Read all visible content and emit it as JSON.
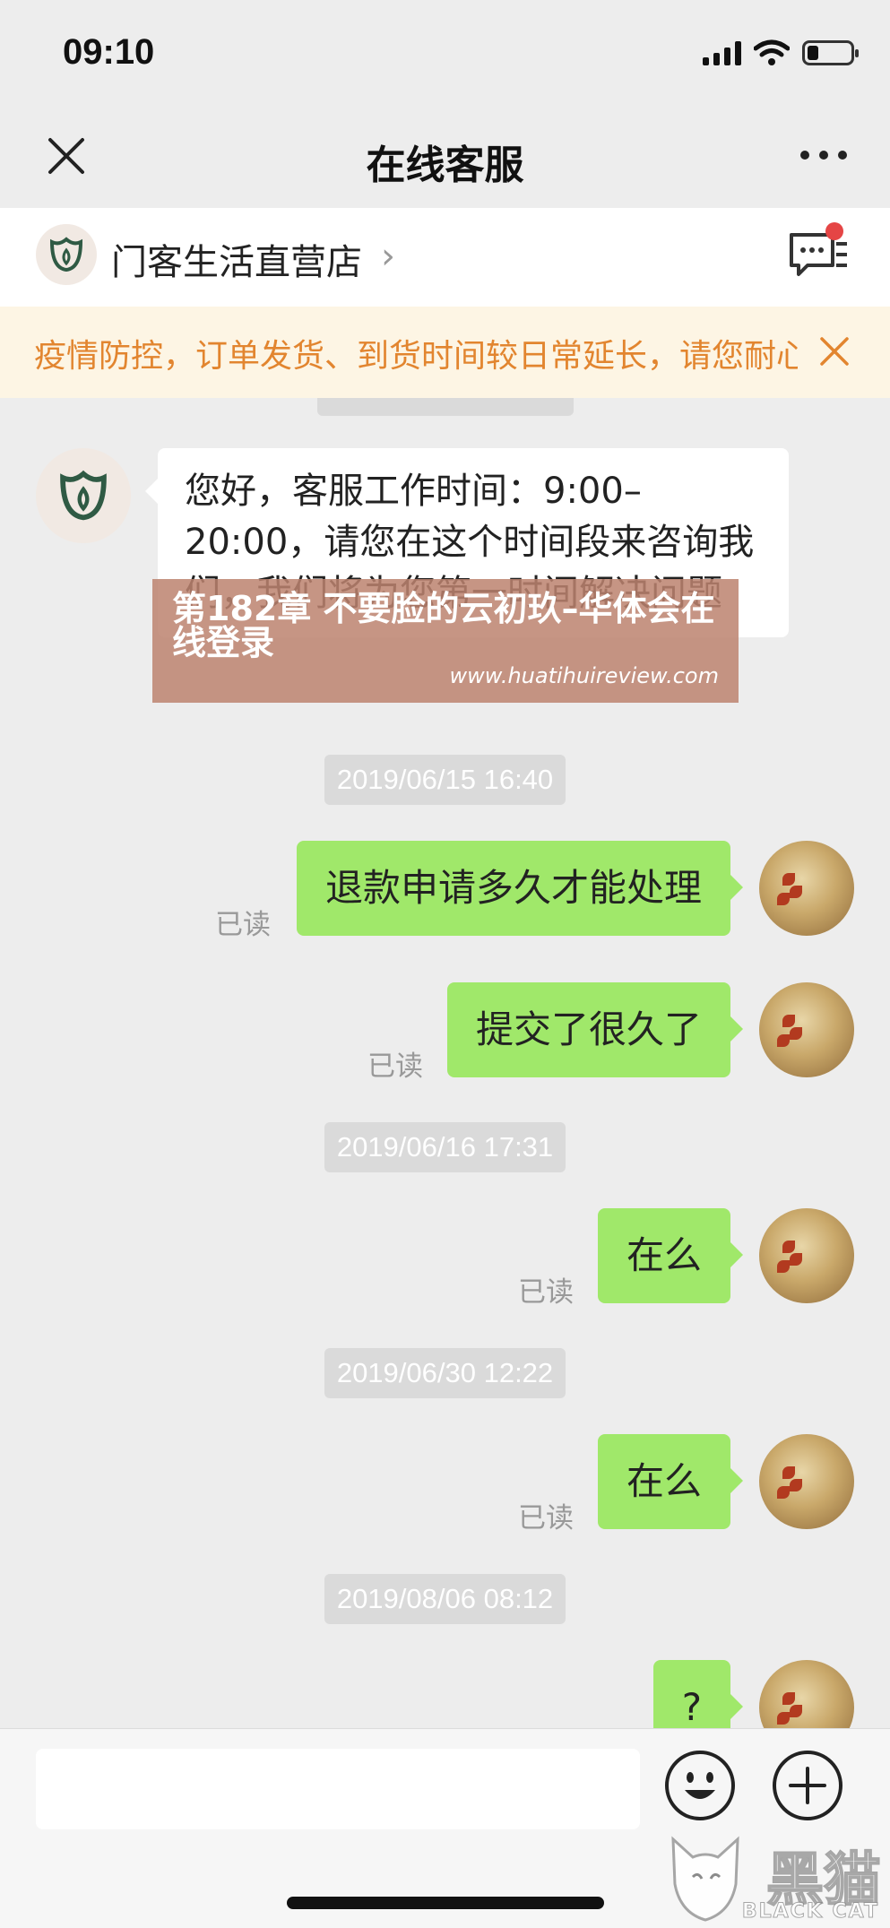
{
  "status": {
    "time": "09:10"
  },
  "nav": {
    "title": "在线客服"
  },
  "shop": {
    "name": "门客生活直营店",
    "chevron": "›"
  },
  "notice": {
    "text": "疫情防控，订单发货、到货时间较日常延长，请您耐心等待"
  },
  "messages": {
    "greeting": "您好，客服工作时间：9:00–20:00，请您在这个时间段来咨询我们，我们将为您第一时间解决问题",
    "ts1": "2019/06/15 16:40",
    "m1": "退款申请多久才能处理",
    "m2": "提交了很久了",
    "ts2": "2019/06/16 17:31",
    "m3": "在么",
    "ts3": "2019/06/30 12:22",
    "m4": "在么",
    "ts4": "2019/08/06 08:12",
    "m5": "?",
    "read": "已读"
  },
  "overlay": {
    "title": "第182章 不要脸的云初玖–华体会在线登录",
    "url": "www.huatihuireview.com"
  },
  "watermark": {
    "brand": "黑猫",
    "sub": "BLACK CAT"
  },
  "icons": [
    "close-icon",
    "more-icon",
    "shop-logo-icon",
    "message-list-icon",
    "notice-close-icon",
    "emoji-icon",
    "plus-icon"
  ],
  "colors": {
    "bubble_self": "#a0e86a",
    "notice_text": "#e2852f",
    "notice_bg": "#fdf5e4",
    "badge": "#e54545",
    "logo_green": "#2f5a44"
  }
}
